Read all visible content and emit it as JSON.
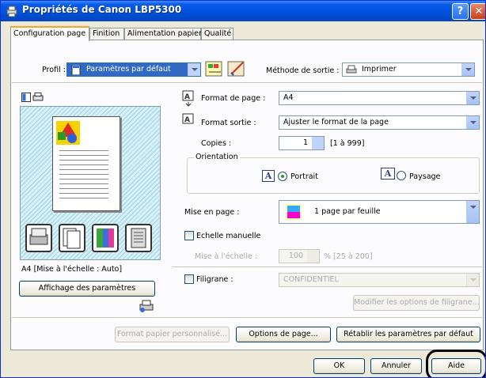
{
  "window": {
    "title": "Propriétés de Canon LBP5300",
    "help_label": "?",
    "close_label": "✕"
  },
  "tabs": [
    {
      "label": "Configuration page"
    },
    {
      "label": "Finition"
    },
    {
      "label": "Alimentation papier"
    },
    {
      "label": "Qualité"
    }
  ],
  "profile": {
    "label": "Profil :",
    "value": "Paramètres par défaut"
  },
  "output": {
    "label": "Méthode de sortie :",
    "value": "Imprimer"
  },
  "page_format": {
    "label": "Format de page :",
    "value": "A4"
  },
  "output_format": {
    "label": "Format sortie :",
    "value": "Ajuster le format de la page"
  },
  "copies": {
    "label": "Copies :",
    "value": "1",
    "range": "[1 à 999]"
  },
  "orientation": {
    "label": "Orientation",
    "portrait": "Portrait",
    "landscape": "Paysage",
    "icon_glyph": "A"
  },
  "layout": {
    "label": "Mise en page :",
    "value": "1 page par feuille"
  },
  "manual_scale": {
    "label": "Echelle manuelle"
  },
  "scaling": {
    "label": "Mise à l'échelle :",
    "value": "100",
    "range": "% [25 à 200]"
  },
  "watermark": {
    "label": "Filigrane :",
    "value": "CONFIDENTIEL",
    "edit_button": "Modifier les options de filigrane..."
  },
  "preview": {
    "caption": "A4 [Mise à l'échelle : Auto]",
    "settings_button": "Affichage des paramètres"
  },
  "footer_buttons": {
    "custom_paper": "Format papier personnalisé...",
    "page_options": "Options de page...",
    "restore": "Rétablir les paramètres par défaut"
  },
  "dialog_buttons": {
    "ok": "OK",
    "cancel": "Annuler",
    "help": "Aide"
  },
  "colors": {
    "titlebar": "#0053e0",
    "tab_active_accent": "#f5a623",
    "dialog_bg": "#ece9d8"
  }
}
